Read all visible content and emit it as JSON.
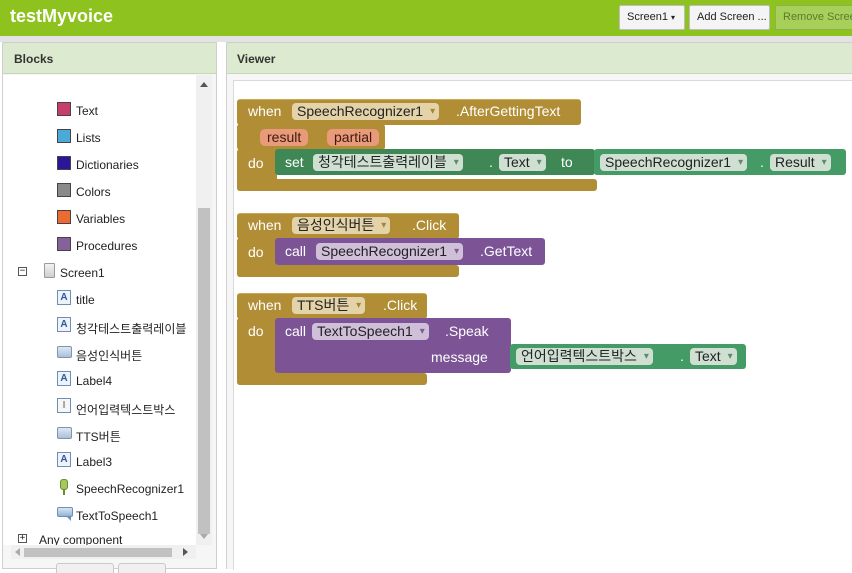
{
  "app": {
    "title": "testMyvoice",
    "screen_selector": "Screen1",
    "add_screen": "Add Screen ...",
    "remove_screen": "Remove Scree"
  },
  "blocks_panel": {
    "header": "Blocks",
    "builtin": [
      {
        "label": "Text",
        "color": "#c73e6e"
      },
      {
        "label": "Lists",
        "color": "#4aa9d8"
      },
      {
        "label": "Dictionaries",
        "color": "#2b169a"
      },
      {
        "label": "Colors",
        "color": "#8a8a8a"
      },
      {
        "label": "Variables",
        "color": "#ec6b33"
      },
      {
        "label": "Procedures",
        "color": "#86619b"
      }
    ],
    "screen": "Screen1",
    "components": [
      {
        "label": "title",
        "icon": "label-icon"
      },
      {
        "label": "청각테스트출력레이블",
        "icon": "label-icon"
      },
      {
        "label": "음성인식버튼",
        "icon": "button-icon"
      },
      {
        "label": "Label4",
        "icon": "label-icon"
      },
      {
        "label": "언어입력텍스트박스",
        "icon": "textbox-icon"
      },
      {
        "label": "TTS버튼",
        "icon": "button-icon"
      },
      {
        "label": "Label3",
        "icon": "label-icon"
      },
      {
        "label": "SpeechRecognizer1",
        "icon": "speech-recognizer-icon"
      },
      {
        "label": "TextToSpeech1",
        "icon": "text-to-speech-icon"
      }
    ],
    "any_component": "Any component"
  },
  "viewer": {
    "header": "Viewer",
    "blocks": {
      "b1": {
        "when": "when",
        "component": "SpeechRecognizer1",
        "event": ".AfterGettingText",
        "param1": "result",
        "param2": "partial",
        "do": "do",
        "set": "set",
        "set_component": "청각테스트출력레이블",
        "dot": ".",
        "set_property": "Text",
        "to": "to",
        "value_component": "SpeechRecognizer1",
        "value_property": "Result"
      },
      "b2": {
        "when": "when",
        "component": "음성인식버튼",
        "event": ".Click",
        "do": "do",
        "call": "call",
        "call_component": "SpeechRecognizer1",
        "method": ".GetText"
      },
      "b3": {
        "when": "when",
        "component": "TTS버튼",
        "event": ".Click",
        "do": "do",
        "call": "call",
        "call_component": "TextToSpeech1",
        "method": ".Speak",
        "arg_label": "message",
        "arg_component": "언어입력텍스트박스",
        "dot": ".",
        "arg_property": "Text"
      }
    }
  }
}
